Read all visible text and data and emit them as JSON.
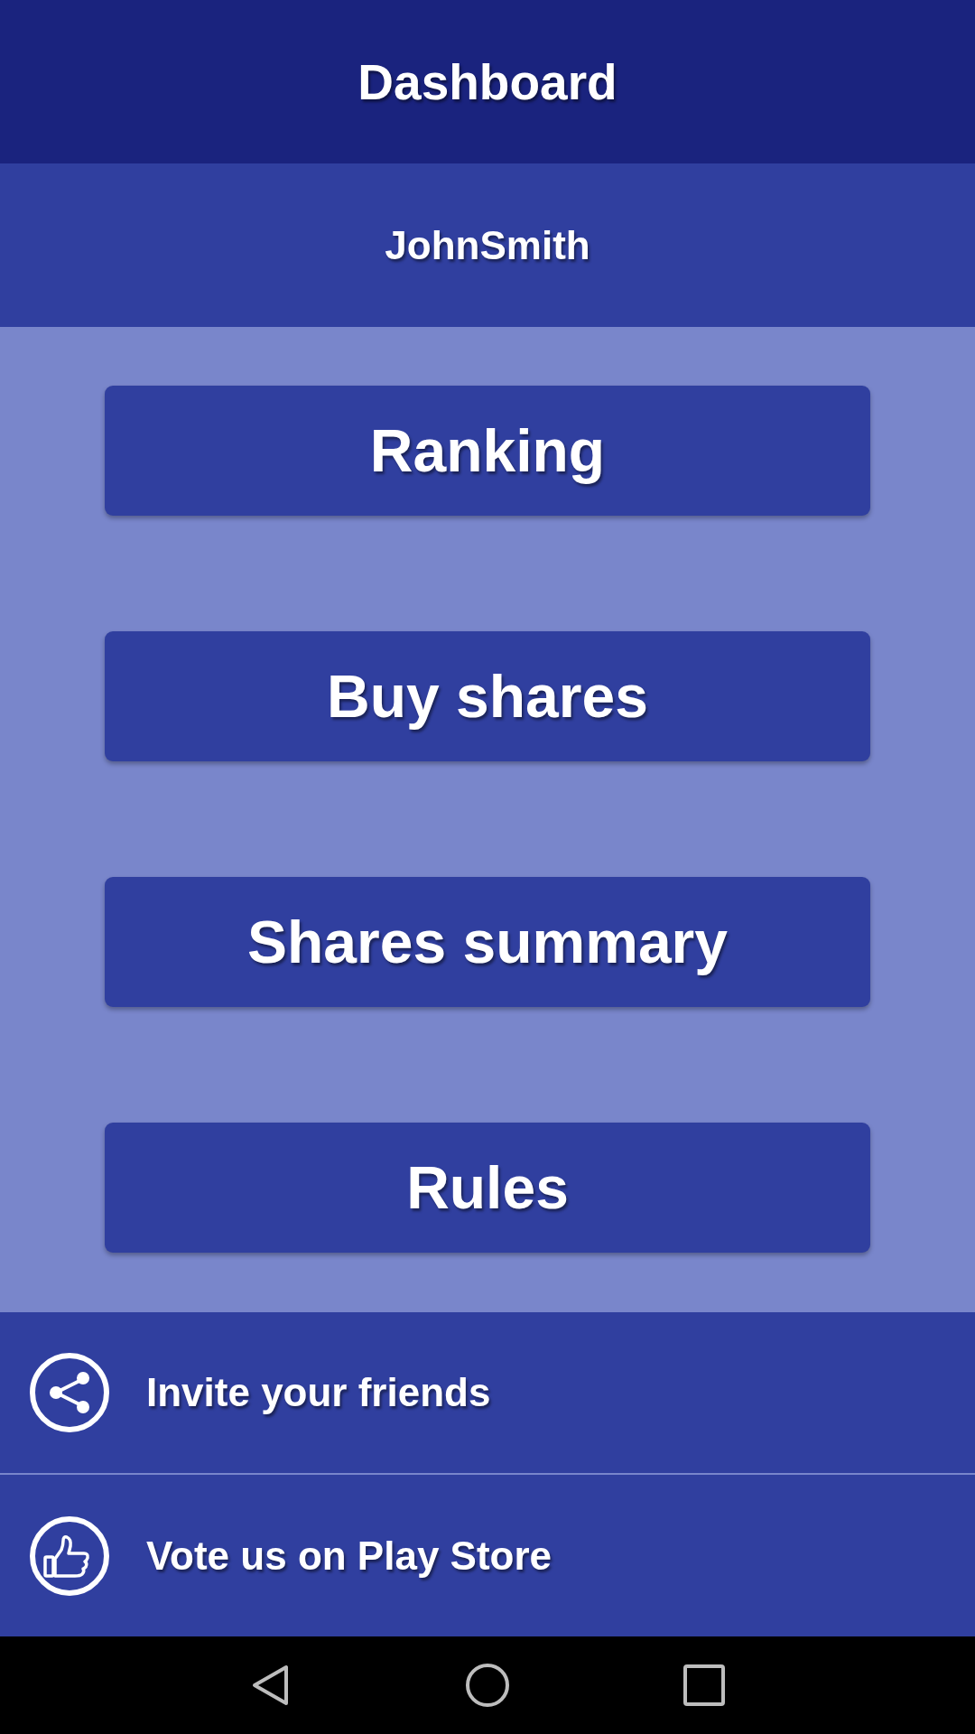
{
  "app_bar": {
    "title": "Dashboard"
  },
  "user": {
    "name": "JohnSmith"
  },
  "menu_buttons": [
    {
      "label": "Ranking"
    },
    {
      "label": "Buy shares"
    },
    {
      "label": "Shares summary"
    },
    {
      "label": "Rules"
    }
  ],
  "bottom_links": [
    {
      "kind": "share",
      "label": "Invite your friends"
    },
    {
      "kind": "like",
      "label": "Vote us on Play Store"
    }
  ]
}
